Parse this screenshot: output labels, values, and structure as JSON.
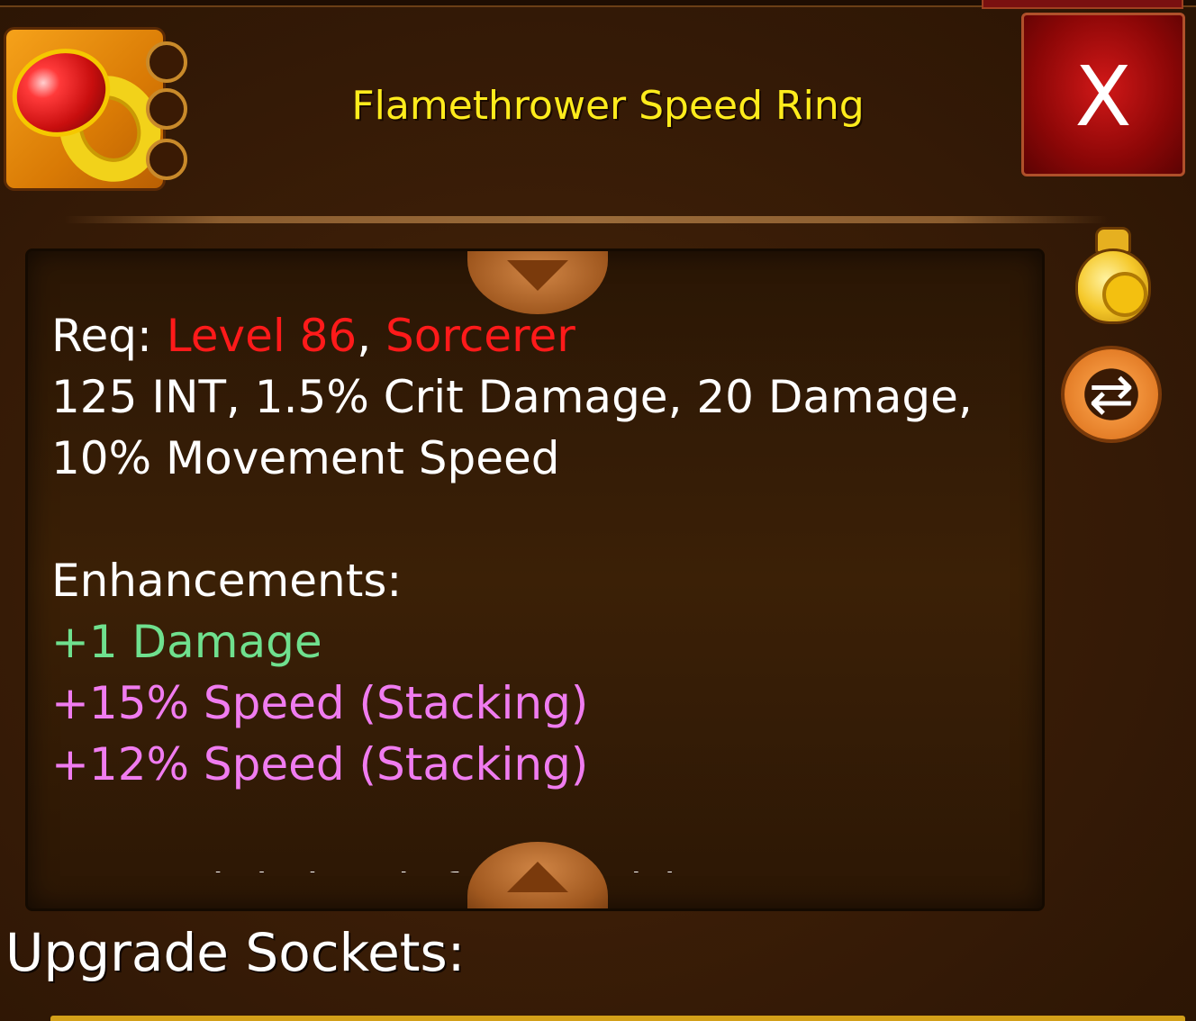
{
  "item": {
    "title": "Flamethrower Speed Ring",
    "enhancement_dots": [
      "green",
      "pink",
      "pink"
    ],
    "socket_count": 3
  },
  "close_button": {
    "label": "X"
  },
  "description": {
    "req_prefix": "Req: ",
    "req_level": "Level 86",
    "req_sep": ", ",
    "req_class": "Sorcerer",
    "stats_line1": "125 INT, 1.5% Crit Damage, 20 Damage,",
    "stats_line2": "10% Movement Speed",
    "enhancements_header": "Enhancements:",
    "enhancements": [
      {
        "text": "+1 Damage",
        "color": "#6fe08e"
      },
      {
        "text": "+15% Speed (Stacking)",
        "color": "#f07cf0"
      },
      {
        "text": "+12% Speed (Stacking)",
        "color": "#f07cf0"
      }
    ],
    "cut_off_line": "A special ring infused with Dragon's"
  },
  "side_icons": {
    "sell": "coin-bag-icon",
    "swap": "swap-arrows-icon",
    "swap_glyph": "⇄"
  },
  "upgrade": {
    "label": "Upgrade Sockets:"
  },
  "colors": {
    "title": "#ffec1c",
    "requirement": "#ff1a1a",
    "text": "#ffffff"
  }
}
